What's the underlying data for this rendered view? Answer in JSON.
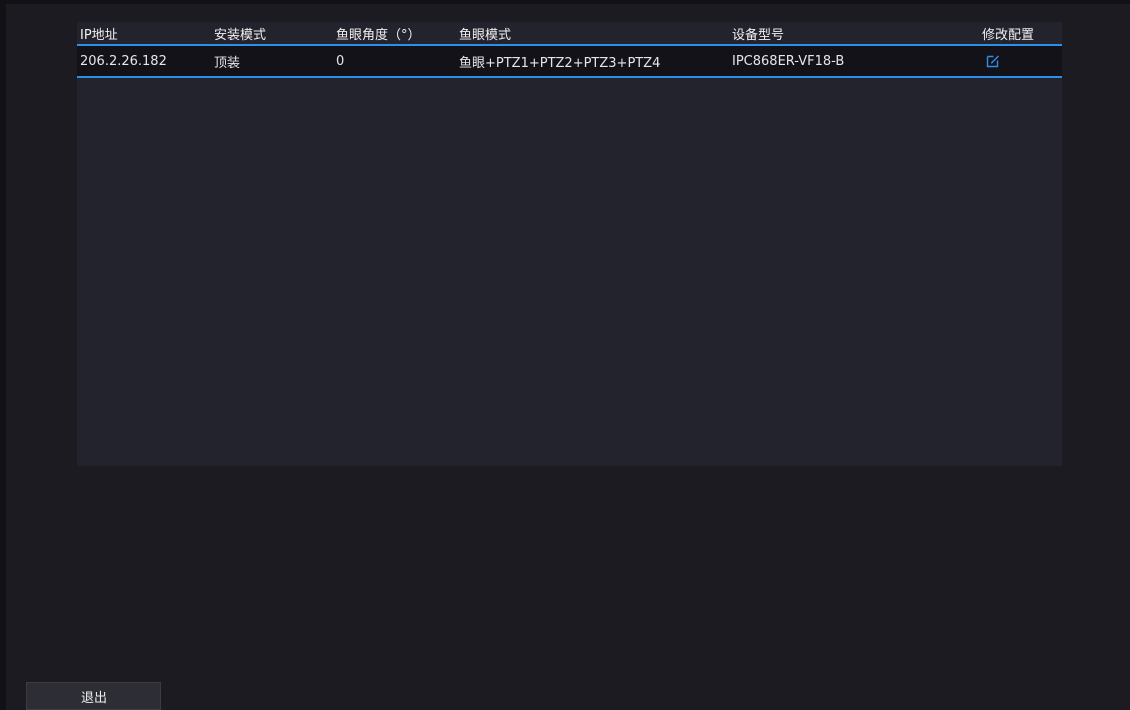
{
  "table": {
    "columns": [
      "IP地址",
      "安装模式",
      "鱼眼角度（°）",
      "鱼眼模式",
      "设备型号",
      "修改配置"
    ],
    "rows": [
      {
        "ip": "206.2.26.182",
        "install_mode": "顶装",
        "fisheye_angle": "0",
        "fisheye_mode": "鱼眼+PTZ1+PTZ2+PTZ3+PTZ4",
        "device_model": "IPC868ER-VF18-B",
        "edit_icon": "edit-icon"
      }
    ]
  },
  "footer": {
    "exit_label": "退出"
  },
  "colors": {
    "accent": "#2f8fe8",
    "panel": "#23232d",
    "background": "#1b1b21"
  }
}
